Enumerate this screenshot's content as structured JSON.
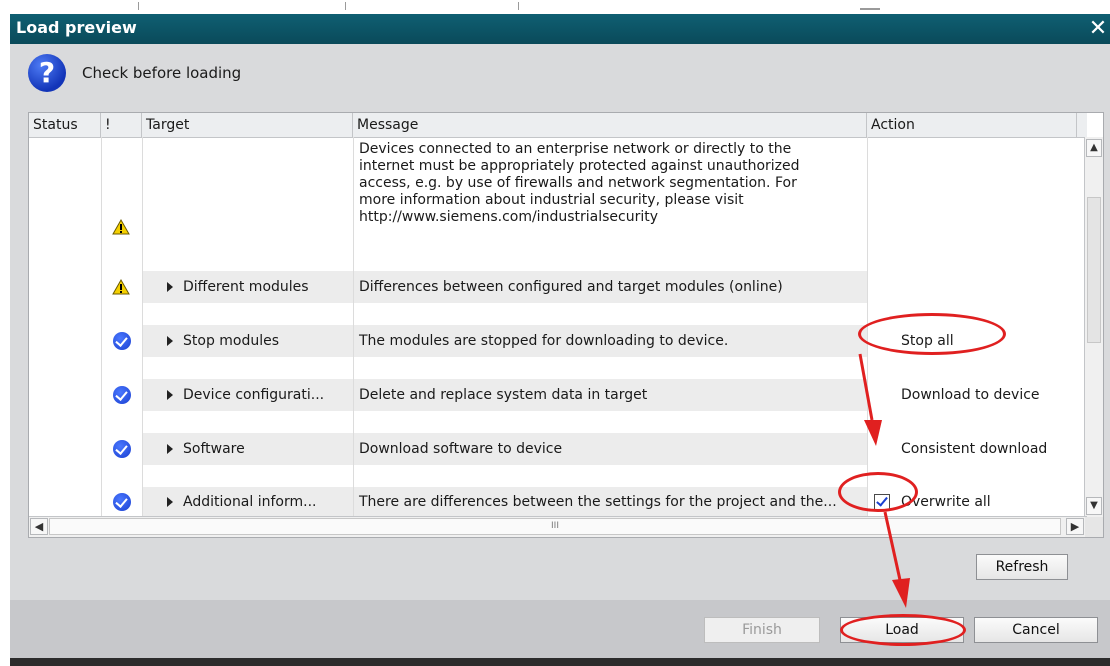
{
  "dialog": {
    "title": "Load preview",
    "close_glyph": "✕",
    "header_icon": "question-mark-icon",
    "header_text": "Check before loading"
  },
  "table": {
    "columns": [
      "Status",
      "!",
      "Target",
      "Message",
      "Action"
    ],
    "rows": [
      {
        "status_icon": "warning-icon",
        "target": "",
        "message_lines": [
          "Devices connected to an enterprise network or directly to the",
          "internet must be appropriately protected against unauthorized",
          "access, e.g. by use of firewalls and network segmentation. For",
          "more information about industrial security, please visit",
          "http://www.siemens.com/industrialsecurity"
        ],
        "action": ""
      },
      {
        "status_icon": "warning-icon",
        "target": "Different modules",
        "message": "Differences between configured and target modules (online)",
        "action": ""
      },
      {
        "status_icon": "ok-check-icon",
        "target": "Stop modules",
        "message": "The modules are stopped for downloading to device.",
        "action": "Stop all"
      },
      {
        "status_icon": "ok-check-icon",
        "target": "Device configurati...",
        "message": "Delete and replace system data in target",
        "action": "Download to device"
      },
      {
        "status_icon": "ok-check-icon",
        "target": "Software",
        "message": "Download software to device",
        "action": "Consistent download"
      },
      {
        "status_icon": "ok-check-icon",
        "target": "Additional inform...",
        "message": "There are differences between the settings for the project and the...",
        "action": "Overwrite all",
        "action_checked": true
      }
    ],
    "hscroll_grip": "III"
  },
  "buttons": {
    "refresh": "Refresh",
    "finish": "Finish",
    "load": "Load",
    "cancel": "Cancel"
  },
  "colors": {
    "titlebar": "#0a4a5a",
    "annotation_red": "#e02020",
    "check_blue": "#1a3fd0",
    "warning_yellow": "#f5d000"
  }
}
